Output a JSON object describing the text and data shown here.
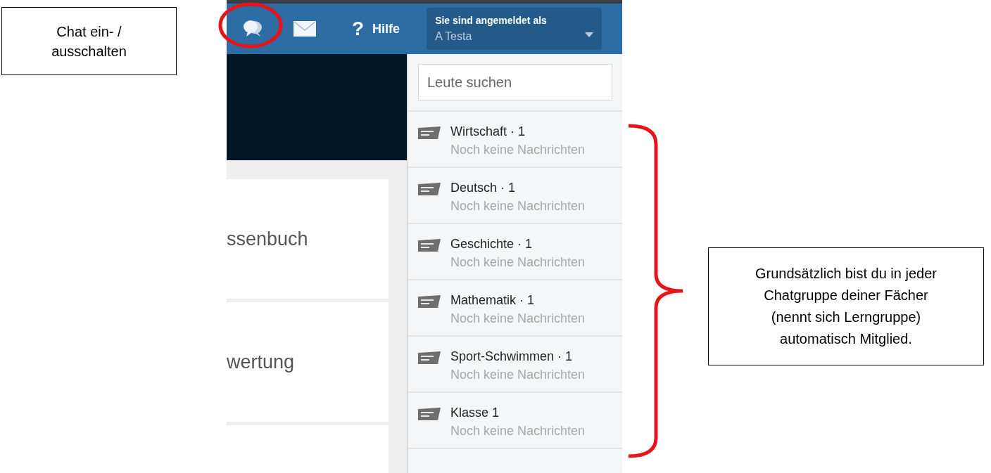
{
  "annotations": [
    {
      "text": "Chat ein- /\nausschalten"
    },
    {
      "text": "Grundsätzlich bist du in jeder\nChatgruppe deiner Fächer\n(nennt sich Lerngruppe)\nautomatisch Mitglied."
    }
  ],
  "topbar": {
    "help_glyph": "?",
    "help_label": "Hilfe",
    "account": {
      "label": "Sie sind angemeldet als",
      "name": "A Testa"
    }
  },
  "content": {
    "cards": [
      {
        "title": "ssenbuch"
      },
      {
        "title": "wertung"
      }
    ]
  },
  "chat": {
    "search": {
      "placeholder": "Leute suchen"
    },
    "groups": [
      {
        "name": "Wirtschaft · 1",
        "preview": "Noch keine Nachrichten"
      },
      {
        "name": "Deutsch · 1",
        "preview": "Noch keine Nachrichten"
      },
      {
        "name": "Geschichte · 1",
        "preview": "Noch keine Nachrichten"
      },
      {
        "name": "Mathematik · 1",
        "preview": "Noch keine Nachrichten"
      },
      {
        "name": "Sport-Schwimmen · 1",
        "preview": "Noch keine Nachrichten"
      },
      {
        "name": "Klasse 1",
        "preview": "Noch keine Nachrichten"
      }
    ]
  }
}
